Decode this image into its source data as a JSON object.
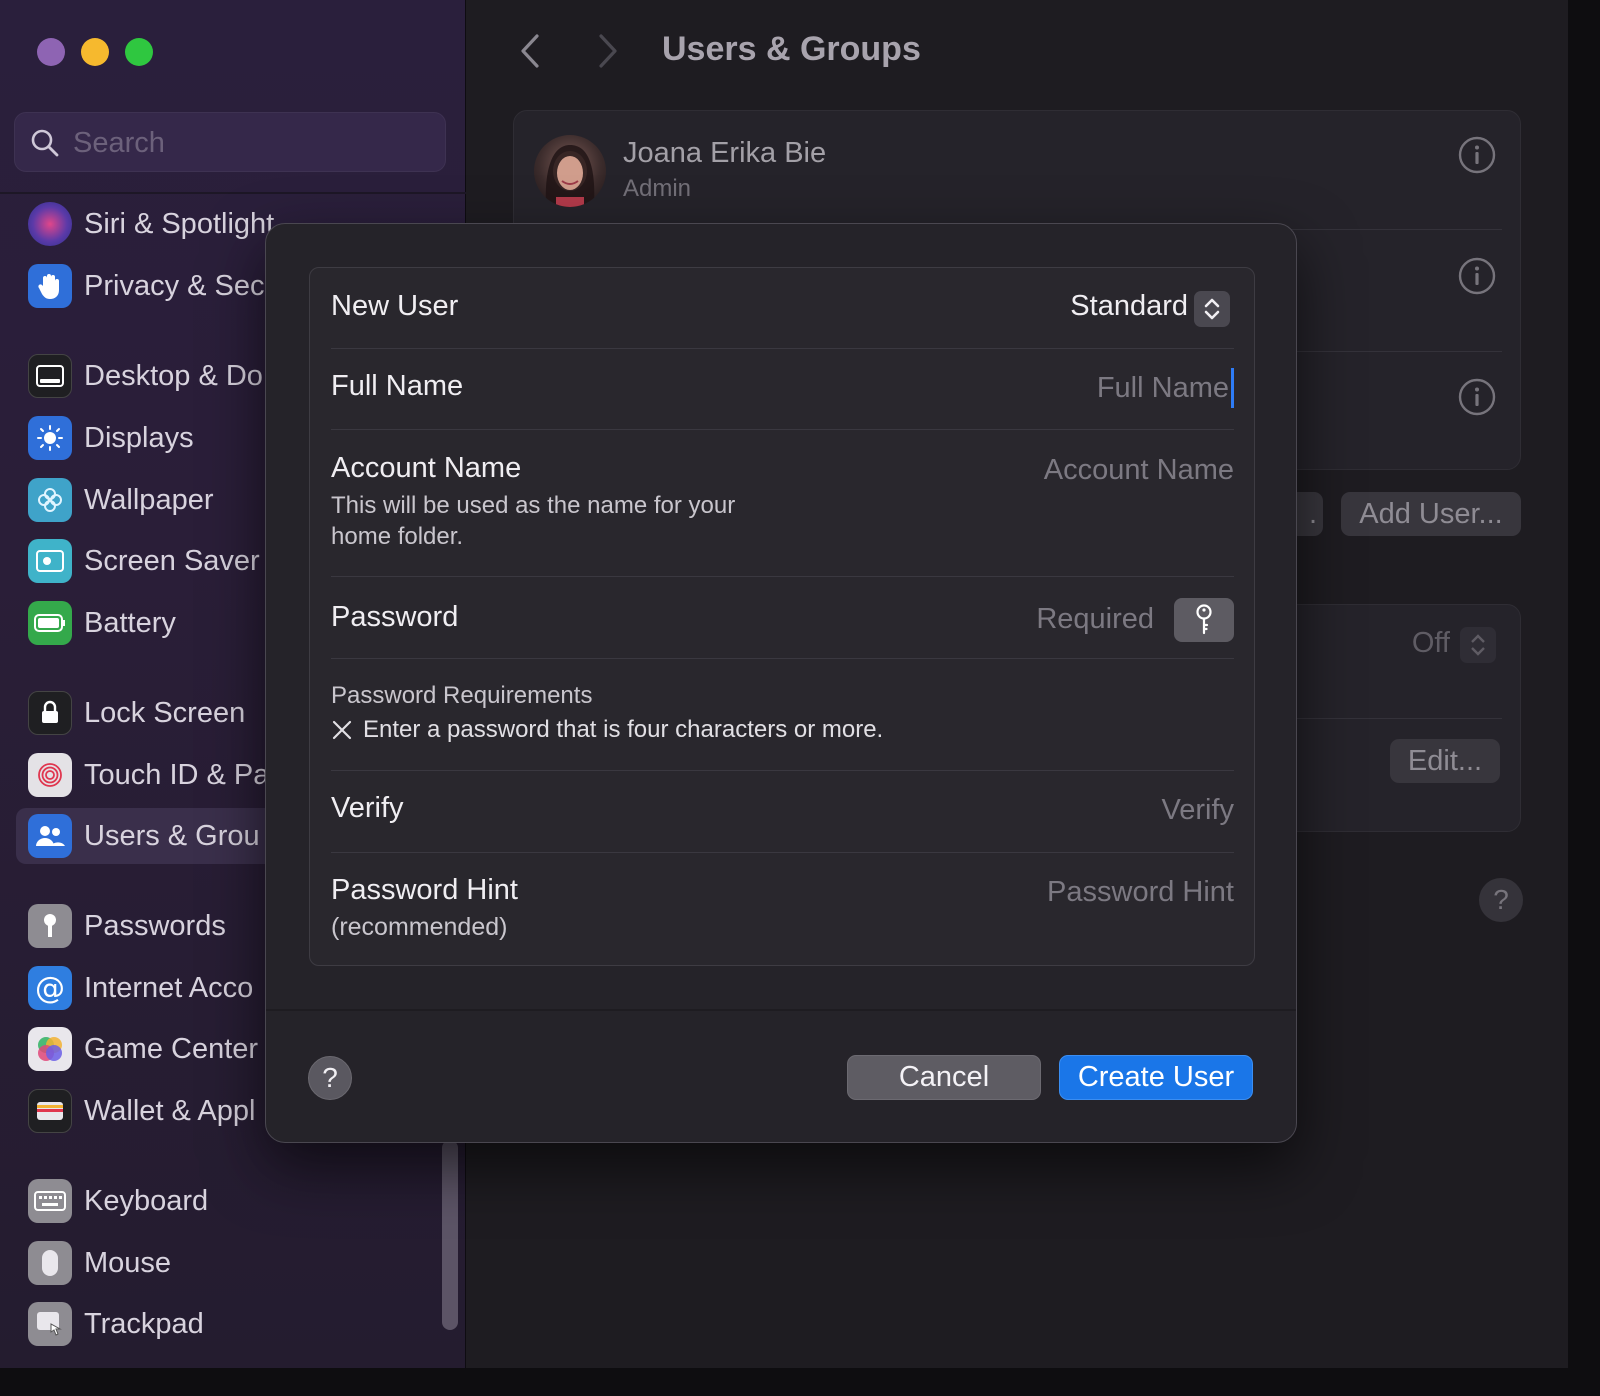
{
  "sidebar": {
    "search_placeholder": "Search",
    "items": [
      {
        "label": "Siri & Spotlight",
        "icon": "siri-icon",
        "color": "#5b3aa8"
      },
      {
        "label": "Privacy & Sec",
        "icon": "hand-icon",
        "color": "#2f6fd9"
      },
      {
        "label": "Desktop & Do",
        "icon": "desktop-icon",
        "color": "#1f1f22"
      },
      {
        "label": "Displays",
        "icon": "sun-icon",
        "color": "#2f6fd9"
      },
      {
        "label": "Wallpaper",
        "icon": "flower-icon",
        "color": "#3fa3c9"
      },
      {
        "label": "Screen Saver",
        "icon": "screen-saver-icon",
        "color": "#3fb3c9"
      },
      {
        "label": "Battery",
        "icon": "battery-icon",
        "color": "#34a94b"
      },
      {
        "label": "Lock Screen",
        "icon": "lock-icon",
        "color": "#1f1f22"
      },
      {
        "label": "Touch ID & Pa",
        "icon": "fingerprint-icon",
        "color": "#e4e2e6"
      },
      {
        "label": "Users & Grou",
        "icon": "users-icon",
        "color": "#2f6fd9"
      },
      {
        "label": "Passwords",
        "icon": "key-icon",
        "color": "#8e8c92"
      },
      {
        "label": "Internet Acco",
        "icon": "at-icon",
        "color": "#2f7ee0"
      },
      {
        "label": "Game Center",
        "icon": "game-center-icon",
        "color": "#e9e7ec"
      },
      {
        "label": "Wallet & Appl",
        "icon": "wallet-icon",
        "color": "#1f1f22"
      },
      {
        "label": "Keyboard",
        "icon": "keyboard-icon",
        "color": "#8e8c92"
      },
      {
        "label": "Mouse",
        "icon": "mouse-icon",
        "color": "#8e8c92"
      },
      {
        "label": "Trackpad",
        "icon": "trackpad-icon",
        "color": "#8e8c92"
      }
    ]
  },
  "main": {
    "title": "Users & Groups",
    "user": {
      "name": "Joana Erika Bie",
      "role": "Admin"
    },
    "add_user_label": "Add User...",
    "partial_button_label": ".",
    "off_label": "Off",
    "edit_label": "Edit...",
    "help_label": "?"
  },
  "dialog": {
    "new_user_label": "New User",
    "account_type": "Standard",
    "full_name": {
      "label": "Full Name",
      "placeholder": "Full Name"
    },
    "account_name": {
      "label": "Account Name",
      "placeholder": "Account Name",
      "hint": "This will be used as the name for your home folder."
    },
    "password": {
      "label": "Password",
      "placeholder": "Required"
    },
    "requirements": {
      "title": "Password Requirements",
      "item": "Enter a password that is four characters or more."
    },
    "verify": {
      "label": "Verify",
      "placeholder": "Verify"
    },
    "hint": {
      "label": "Password Hint",
      "sub": "(recommended)",
      "placeholder": "Password Hint"
    },
    "help_label": "?",
    "cancel_label": "Cancel",
    "create_label": "Create User",
    "accent_color": "#1a76e8"
  }
}
